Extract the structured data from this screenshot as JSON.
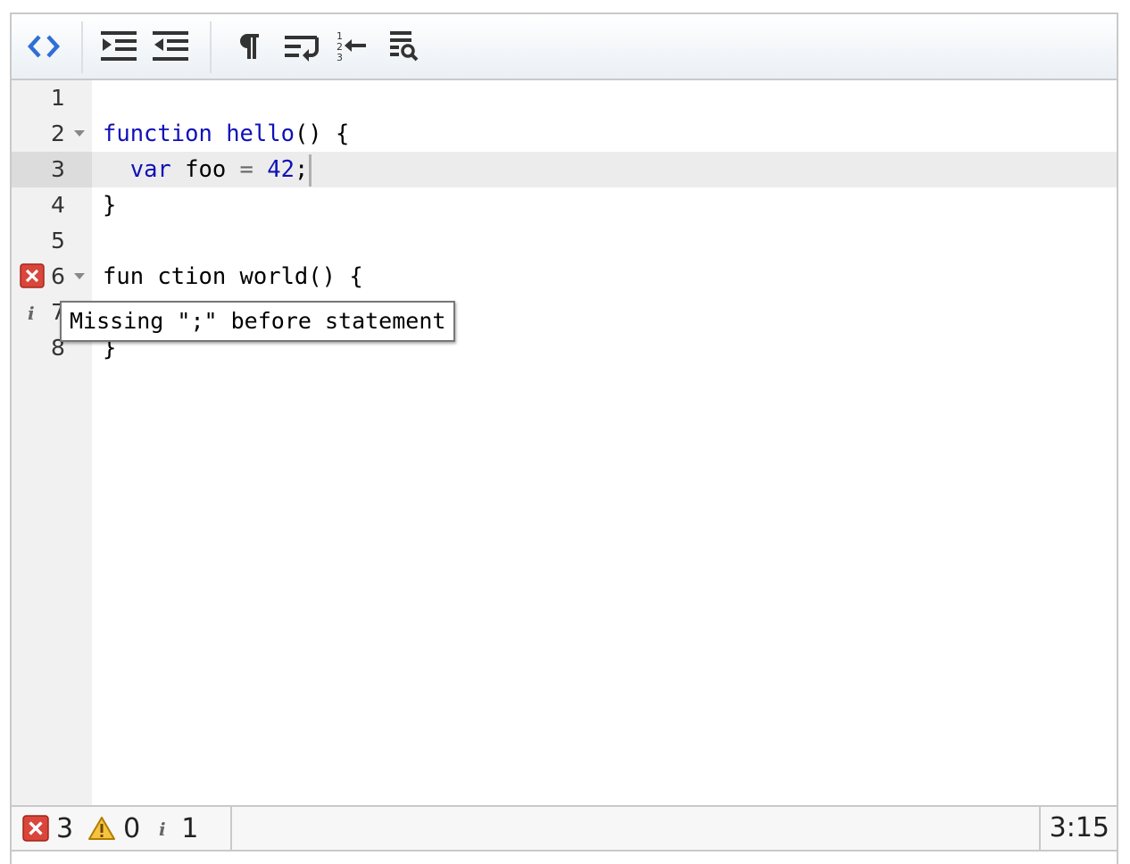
{
  "toolbar": {
    "buttons": [
      {
        "name": "toggle-source-button",
        "icon": "code-brackets-icon"
      },
      {
        "name": "indent-button",
        "icon": "indent-icon"
      },
      {
        "name": "outdent-button",
        "icon": "outdent-icon"
      },
      {
        "name": "show-invisibles-button",
        "icon": "pilcrow-icon"
      },
      {
        "name": "word-wrap-button",
        "icon": "word-wrap-icon"
      },
      {
        "name": "line-numbers-button",
        "icon": "line-numbers-icon"
      },
      {
        "name": "search-button",
        "icon": "search-lines-icon"
      }
    ],
    "accent_color": "#2f6fd6"
  },
  "editor": {
    "line_numbers": [
      "1",
      "2",
      "3",
      "4",
      "5",
      "6",
      "7",
      "8"
    ],
    "lines": {
      "l2_kw": "function",
      "l2_fn": "hello",
      "l2_rest": "() {",
      "l3_indent": "  ",
      "l3_kw": "var",
      "l3_mid": " foo ",
      "l3_op": "=",
      "l3_num": "42",
      "l3_end": ";",
      "l4": "}",
      "l6": "fun ction world() {",
      "l8": "}"
    },
    "active_line": 3,
    "tooltip": "Missing \";\" before statement"
  },
  "statusbar": {
    "errors": "3",
    "warnings": "0",
    "infos": "1",
    "cursor_position": "3:15",
    "error_color": "#d9463b",
    "warning_color": "#f0b400"
  }
}
